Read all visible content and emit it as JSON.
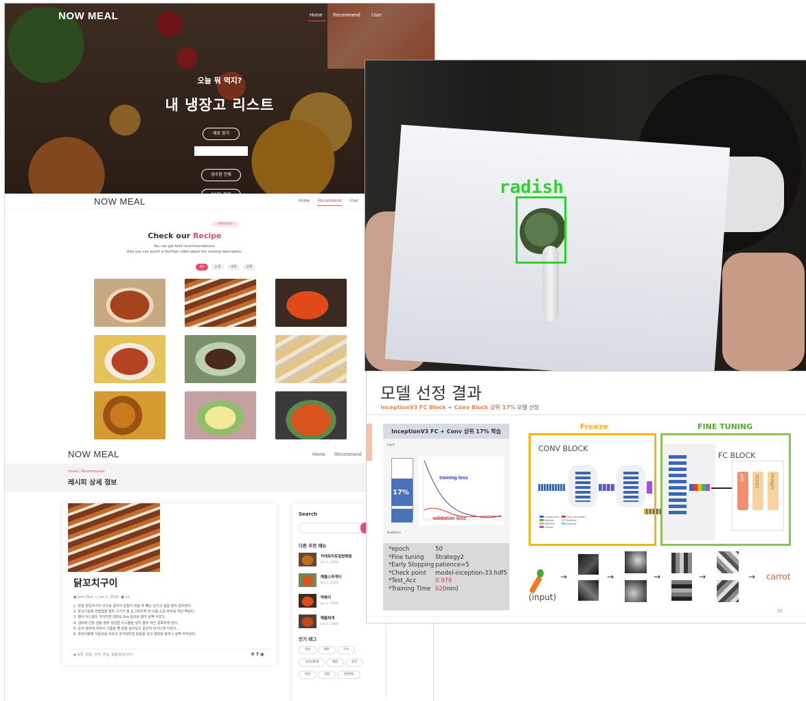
{
  "hero": {
    "brand": "NOW MEAL",
    "nav": [
      "Home",
      "Recommend",
      "User"
    ],
    "subtitle": "오늘 뭐 먹지?",
    "title": "내 냉장고 리스트",
    "btn_top": "재료 찾기",
    "btn_bottom": "냉수정 전체",
    "btn_cut": "DATA 전체"
  },
  "recommend": {
    "brand": "NOW MEAL",
    "nav": [
      "Home",
      "Recommend",
      "User"
    ],
    "badge": "SERVICES",
    "heading_plain": "Check our ",
    "heading_accent": "Recipe",
    "desc1": "You can get food recommendations.",
    "desc2": "Also you can watch a YouTube video about the cooking description.",
    "filters": [
      "All",
      "1개",
      "4개",
      "2개"
    ],
    "accent": "#e84a6a"
  },
  "detail": {
    "brand": "NOW MEAL",
    "nav": [
      "Home",
      "Recommend"
    ],
    "breadcrumb": "Home  /  Recommends",
    "page_title": "레시피 상세 정보",
    "recipe_title": "닭꼬치구이",
    "author": "John Doe",
    "date": "Jan 1, 2020",
    "comments": "12",
    "steps": [
      "1. 닭을 한입크기의 것으로 골라서 껍질이 섞을 후 빼는 남기고 설을 발라 준비한다.",
      "2. 닭고기살에 한밤밥을 발라 고기가 잘 도그라지게 한 다음 소금 후추를 약간 뿌린다.",
      "3. 팬이 어느정도 익어가면 대파도 6㎝ 길이로 썰어 살짝 익힌다.",
      "4. 냄비에 간장 설탕 청주 생강즙 다시물을 넣어 끓여 약간 걸쭉하게 된다.",
      "5. 손의 냄비에 치져서 기름을 뺀 닭을 집어넣고 윤곤히 뒤기니게 익힌다.",
      "6. 프라이팬에 식용유를 두르고 뜨거워지면 닭살을 넣고 양파로 놓하시 살짝 지져낸다."
    ],
    "tags_line": "육류, 닭을, 간식, 주입, 볶음/튀김/구이",
    "sidebar": {
      "search_label": "Search",
      "other_label": "다른 추천 메뉴",
      "items": [
        {
          "title": "카레토마토덮밥볶음",
          "date": "Jan 1, 2020"
        },
        {
          "title": "해물스파게티",
          "date": "Jan 1, 2020"
        },
        {
          "title": "떡볶이",
          "date": "Jan 1, 2020"
        },
        {
          "title": "해물찌개",
          "date": "Jan 1, 2020"
        }
      ],
      "tags_label": "인기 태그",
      "tags": [
        "밀잔",
        "패튼",
        "구수",
        "국/탕/찌개",
        "매콤",
        "볶이",
        "튀김",
        "사형",
        "반/면류"
      ]
    }
  },
  "cam": {
    "label": "radish",
    "box_color": "#2fd22f"
  },
  "slide": {
    "title": "모델 선정 결과",
    "subtitle_accent": "InceptionV3 FC Block + Conv Block 상위 17%",
    "subtitle_rest": " 모델 선정",
    "box_title": "InceptionV3 FC + Conv 상위 17% 학습",
    "stack_top": "Input",
    "stack_bottom": "Prediction",
    "percent": "17%",
    "train_loss": "training loss",
    "val_loss": "validation loss",
    "params": [
      {
        "k": "*epoch",
        "v": "50",
        "red": false
      },
      {
        "k": "*Fine tuning",
        "v": "Strategy2",
        "red": false
      },
      {
        "k": "*Early Stopping",
        "v": "patience=5",
        "red": false
      },
      {
        "k": "*Check point",
        "v": "model-inception-33.hdf5",
        "red": false
      },
      {
        "k": "*Test_Acc",
        "v": "0.976",
        "red": true
      },
      {
        "k": "*Training Time",
        "v": "62",
        "v2": "(min)",
        "red": true
      }
    ],
    "freeze": "Freeze",
    "fine_tuning": "FINE TUNING",
    "conv_block": "CONV BLOCK",
    "fc_block": "FC BLOCK",
    "fc_layers": [
      "GAP",
      "DENSE",
      "softmax"
    ],
    "legend": [
      "Convolution",
      "AvgPool",
      "MaxPool",
      "Concat",
      "Fully connected",
      "Softmax",
      "Dropout"
    ],
    "input_label": "(input)",
    "result": "carrot",
    "page": "30",
    "colors": {
      "freeze": "#f5b31a",
      "fine": "#7cc24a",
      "accent": "#f0844f",
      "red": "#e53935"
    }
  }
}
